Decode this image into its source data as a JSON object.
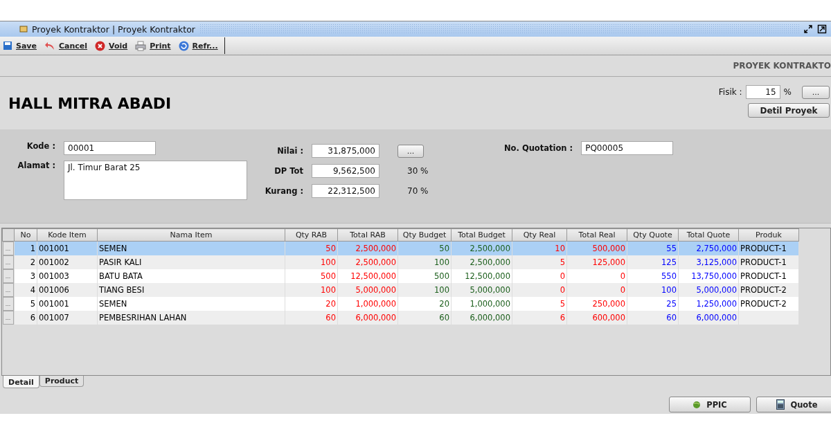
{
  "window": {
    "title": "Proyek Kontraktor | Proyek Kontraktor"
  },
  "toolbar": [
    {
      "label": "Save",
      "kind": "save"
    },
    {
      "label": "Cancel",
      "kind": "cancel"
    },
    {
      "label": "Void",
      "kind": "void"
    },
    {
      "label": "Print",
      "kind": "print"
    },
    {
      "label": "Refr...",
      "kind": "refresh"
    }
  ],
  "module_title": "PROYEK KONTRAKTO",
  "project_name": "HALL MITRA ABADI",
  "fisik": {
    "label": "Fisik :",
    "value": "15",
    "unit": "%",
    "button": "...",
    "detail_button": "Detil Proyek"
  },
  "form": {
    "kode": {
      "label": "Kode :",
      "value": "00001"
    },
    "alamat": {
      "label": "Alamat :",
      "value": "Jl. Timur Barat 25"
    },
    "nilai": {
      "label": "Nilai :",
      "value": "31,875,000",
      "button": "..."
    },
    "dp_total": {
      "label": "DP Tot",
      "value": "9,562,500",
      "percent": "30 %"
    },
    "kurang": {
      "label": "Kurang :",
      "value": "22,312,500",
      "percent": "70 %"
    },
    "quotation": {
      "label": "No. Quotation :",
      "value": "PQ00005"
    }
  },
  "table": {
    "columns": [
      {
        "label": "No",
        "kind": "number",
        "color": "#000000"
      },
      {
        "label": "Kode Item",
        "kind": "text",
        "color": "#000000"
      },
      {
        "label": "Nama Item",
        "kind": "text",
        "color": "#000000"
      },
      {
        "label": "Qty RAB",
        "kind": "number",
        "color": "#ff0000"
      },
      {
        "label": "Total RAB",
        "kind": "number",
        "color": "#ff0000"
      },
      {
        "label": "Qty Budget",
        "kind": "number",
        "color": "#1a5e1a"
      },
      {
        "label": "Total Budget",
        "kind": "number",
        "color": "#1a5e1a"
      },
      {
        "label": "Qty Real",
        "kind": "number",
        "color": "#ff0000"
      },
      {
        "label": "Total Real",
        "kind": "number",
        "color": "#ff0000"
      },
      {
        "label": "Qty Quote",
        "kind": "number",
        "color": "#0000ff"
      },
      {
        "label": "Total Quote",
        "kind": "number",
        "color": "#0000ff"
      },
      {
        "label": "Produk",
        "kind": "text",
        "color": "#000000"
      }
    ],
    "rows": [
      {
        "row_button": "...",
        "selected": true,
        "cells": [
          "1",
          "001001",
          "SEMEN",
          "50",
          "2,500,000",
          "50",
          "2,500,000",
          "10",
          "500,000",
          "55",
          "2,750,000",
          "PRODUCT-1"
        ]
      },
      {
        "row_button": "...",
        "selected": false,
        "cells": [
          "2",
          "001002",
          "PASIR KALI",
          "100",
          "2,500,000",
          "100",
          "2,500,000",
          "5",
          "125,000",
          "125",
          "3,125,000",
          "PRODUCT-1"
        ]
      },
      {
        "row_button": "...",
        "selected": false,
        "cells": [
          "3",
          "001003",
          "BATU BATA",
          "500",
          "12,500,000",
          "500",
          "12,500,000",
          "0",
          "0",
          "550",
          "13,750,000",
          "PRODUCT-1"
        ]
      },
      {
        "row_button": "...",
        "selected": false,
        "cells": [
          "4",
          "001006",
          "TIANG BESI",
          "100",
          "5,000,000",
          "100",
          "5,000,000",
          "0",
          "0",
          "100",
          "5,000,000",
          "PRODUCT-2"
        ]
      },
      {
        "row_button": "...",
        "selected": false,
        "cells": [
          "5",
          "001001",
          "SEMEN",
          "20",
          "1,000,000",
          "20",
          "1,000,000",
          "5",
          "250,000",
          "25",
          "1,250,000",
          "PRODUCT-2"
        ]
      },
      {
        "row_button": "...",
        "selected": false,
        "cells": [
          "6",
          "001007",
          "PEMBESRIHAN LAHAN",
          "60",
          "6,000,000",
          "60",
          "6,000,000",
          "6",
          "600,000",
          "60",
          "6,000,000",
          ""
        ]
      }
    ]
  },
  "tabs": [
    {
      "label": "Detail",
      "selected": true
    },
    {
      "label": "Product",
      "selected": false
    }
  ],
  "buttons": [
    {
      "label": "PPIC",
      "kind": "ppic"
    },
    {
      "label": "Quote",
      "kind": "quote"
    }
  ]
}
